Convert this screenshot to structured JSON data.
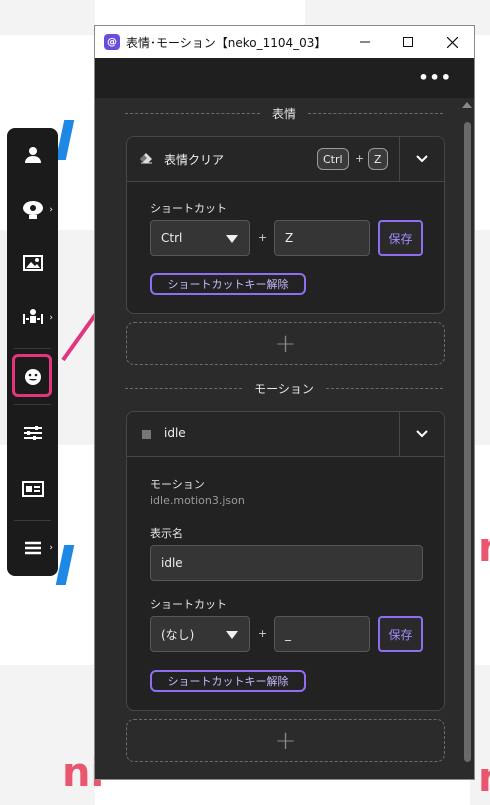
{
  "window": {
    "title": "表情･モーション【neko_1104_03】",
    "app_icon": "@",
    "more_label": "•••"
  },
  "toolbar": {
    "items": [
      {
        "icon": "person-icon"
      },
      {
        "icon": "webcam-icon"
      },
      {
        "icon": "image-icon"
      },
      {
        "icon": "tracking-icon"
      },
      {
        "icon": "face-icon"
      },
      {
        "icon": "sliders-icon"
      },
      {
        "icon": "id-card-icon"
      },
      {
        "icon": "menu-icon"
      }
    ],
    "chevron": "›"
  },
  "expressions": {
    "section_label": "表情",
    "card": {
      "title": "表情クリア",
      "key_mod": "Ctrl",
      "key_plus": "+",
      "key": "Z",
      "shortcut_label": "ショートカット",
      "modifier_value": "Ctrl",
      "plus": "+",
      "key_value": "Z",
      "save_label": "保存",
      "clear_label": "ショートカットキー解除"
    },
    "add_label": "+"
  },
  "motions": {
    "section_label": "モーション",
    "card": {
      "title": "idle",
      "motion_label": "モーション",
      "motion_file": "idle.motion3.json",
      "display_name_label": "表示名",
      "display_name_value": "idle",
      "shortcut_label": "ショートカット",
      "modifier_value": "(なし)",
      "plus": "+",
      "key_value": "_",
      "save_label": "保存",
      "clear_label": "ショートカットキー解除"
    },
    "add_label": "+"
  },
  "colors": {
    "accent": "#8f6ff0",
    "highlight": "#e2357c",
    "panel": "#2b2b2b"
  }
}
